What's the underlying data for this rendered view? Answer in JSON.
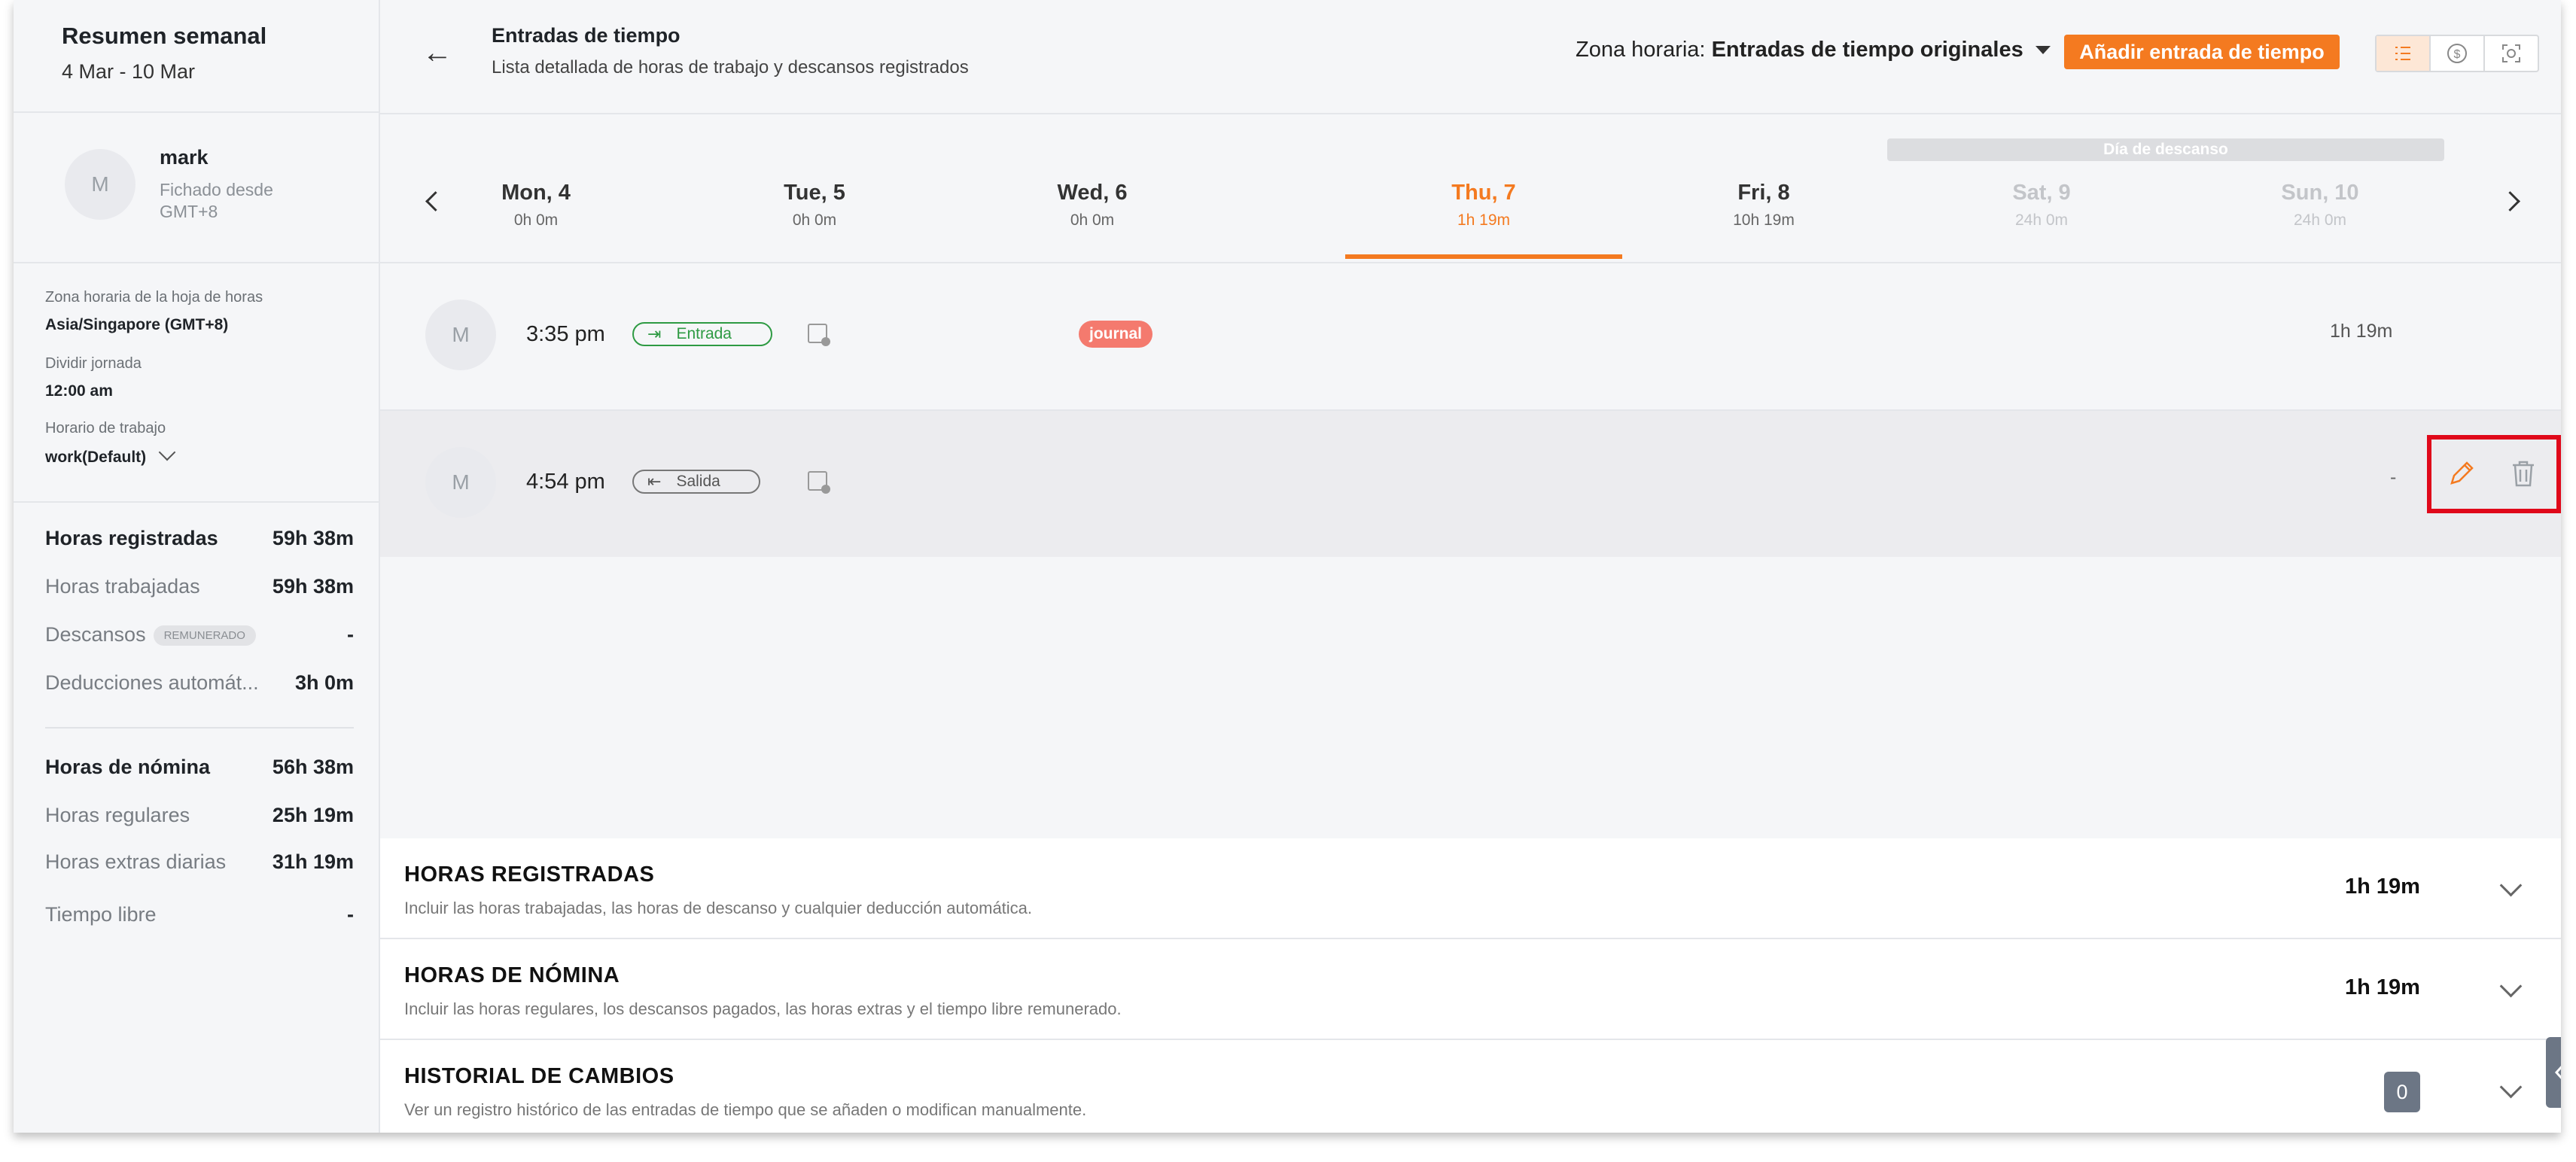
{
  "summary": {
    "title": "Resumen semanal",
    "range": "4 Mar - 10 Mar"
  },
  "user": {
    "avatar_letter": "M",
    "name": "mark",
    "since": "Fichado desde GMT+8"
  },
  "settings": {
    "tz_label": "Zona horaria de la hoja de horas",
    "tz_value": "Asia/Singapore (GMT+8)",
    "split_label": "Dividir jornada",
    "split_value": "12:00 am",
    "schedule_label": "Horario de trabajo",
    "schedule_value": "work(Default)"
  },
  "stats": {
    "tracked_label": "Horas registradas",
    "tracked_value": "59h 38m",
    "worked_label": "Horas trabajadas",
    "worked_value": "59h 38m",
    "breaks_label": "Descansos",
    "breaks_badge": "REMUNERADO",
    "breaks_value": "-",
    "auto_label": "Deducciones automát...",
    "auto_value": "3h 0m",
    "payroll_label": "Horas de nómina",
    "payroll_value": "56h 38m",
    "regular_label": "Horas regulares",
    "regular_value": "25h 19m",
    "overtime_label": "Horas extras diarias",
    "overtime_value": "31h 19m",
    "timeoff_label": "Tiempo libre",
    "timeoff_value": "-"
  },
  "header": {
    "back_icon": "←",
    "title": "Entradas de tiempo",
    "subtitle": "Lista detallada de horas de trabajo y descansos registrados",
    "tz_prefix": "Zona horaria:",
    "tz_value": "Entradas de tiempo originales",
    "add_button": "Añadir entrada de tiempo"
  },
  "rest_day_label": "Día de descanso",
  "days": [
    {
      "name": "Mon, 4",
      "hours": "0h 0m"
    },
    {
      "name": "Tue, 5",
      "hours": "0h 0m"
    },
    {
      "name": "Wed, 6",
      "hours": "0h 0m"
    },
    {
      "name": "Thu, 7",
      "hours": "1h 19m"
    },
    {
      "name": "Fri, 8",
      "hours": "10h 19m"
    },
    {
      "name": "Sat, 9",
      "hours": "24h 0m"
    },
    {
      "name": "Sun, 10",
      "hours": "24h 0m"
    }
  ],
  "entries": [
    {
      "avatar": "M",
      "time": "3:35 pm",
      "type": "Entrada",
      "tag": "journal",
      "duration": "1h 19m"
    },
    {
      "avatar": "M",
      "time": "4:54 pm",
      "type": "Salida",
      "duration": "-"
    }
  ],
  "sections": [
    {
      "title": "HORAS REGISTRADAS",
      "subtitle": "Incluir las horas trabajadas, las horas de descanso y cualquier deducción automática.",
      "value": "1h 19m"
    },
    {
      "title": "HORAS DE NÓMINA",
      "subtitle": "Incluir las horas regulares, los descansos pagados, las horas extras y el tiempo libre remunerado.",
      "value": "1h 19m"
    },
    {
      "title": "HISTORIAL DE CAMBIOS",
      "subtitle": "Ver un registro histórico de las entradas de tiempo que se añaden o modifican manualmente.",
      "value": "0"
    }
  ],
  "colors": {
    "accent": "#f47a20",
    "in": "#2e9a43",
    "tag": "#f47a6e",
    "highlight": "#e0081a"
  }
}
